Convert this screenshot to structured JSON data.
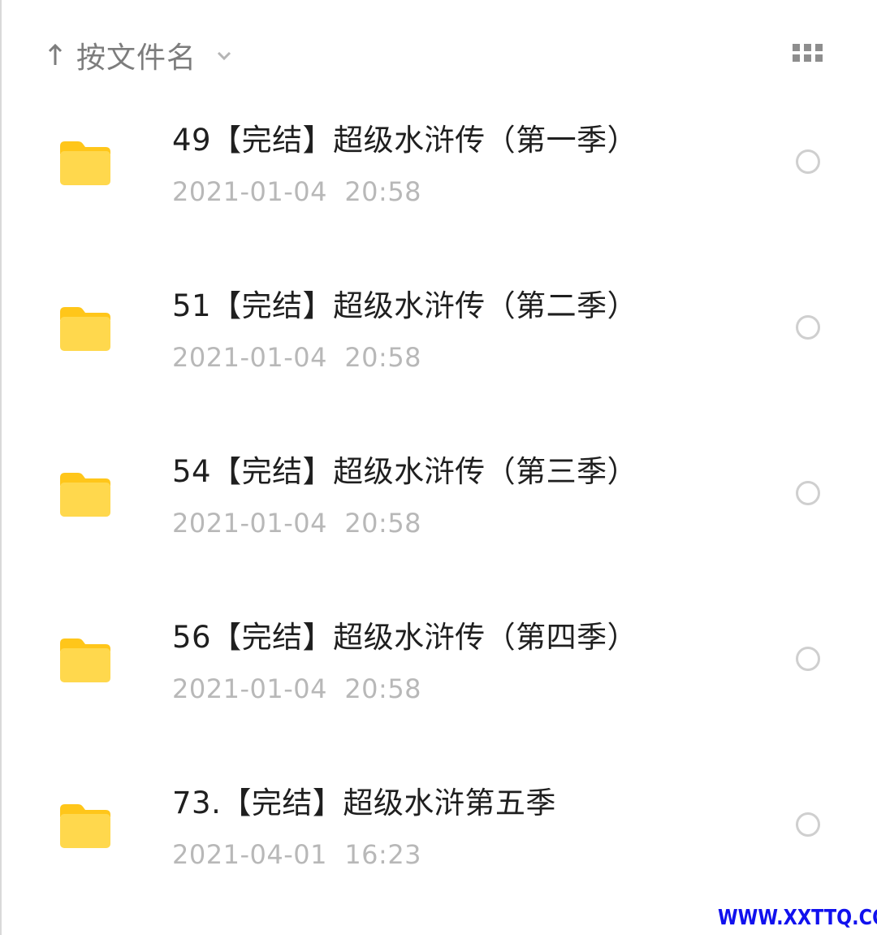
{
  "header": {
    "sort_icon": "arrow-up-icon",
    "sort_label": "按文件名",
    "sort_dropdown_icon": "chevron-down-icon",
    "view_toggle_icon": "grid-view-icon"
  },
  "files": [
    {
      "name": "49【完结】超级水浒传（第一季）",
      "date": "2021-01-04  20:58",
      "icon": "folder-icon"
    },
    {
      "name": "51【完结】超级水浒传（第二季）",
      "date": "2021-01-04  20:58",
      "icon": "folder-icon"
    },
    {
      "name": "54【完结】超级水浒传（第三季）",
      "date": "2021-01-04  20:58",
      "icon": "folder-icon"
    },
    {
      "name": "56【完结】超级水浒传（第四季）",
      "date": "2021-01-04  20:58",
      "icon": "folder-icon"
    },
    {
      "name": "73.【完结】超级水浒第五季",
      "date": "2021-04-01  16:23",
      "icon": "folder-icon"
    }
  ],
  "watermark": "WWW.XXTTQ.COM",
  "colors": {
    "folder": "#FFD84D",
    "folder_tab": "#FFC61A",
    "text_primary": "#1f1f1f",
    "text_secondary": "#b8b8b8",
    "watermark": "#1111ee"
  }
}
